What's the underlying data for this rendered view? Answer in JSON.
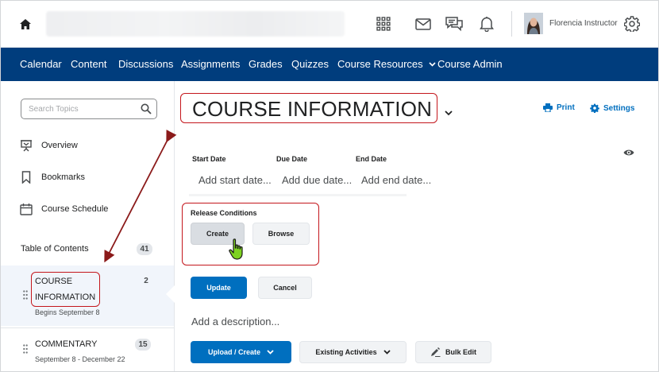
{
  "header": {
    "user_name": "Florencia Instructor",
    "icons": [
      "home-icon",
      "waffle-icon",
      "mail-icon",
      "chat-icon",
      "bell-icon",
      "gear-icon"
    ]
  },
  "nav": {
    "items": [
      {
        "label": "Calendar"
      },
      {
        "label": "Content"
      },
      {
        "label": "Discussions"
      },
      {
        "label": "Assignments"
      },
      {
        "label": "Grades"
      },
      {
        "label": "Quizzes"
      },
      {
        "label": "Course Resources",
        "has_menu": true
      },
      {
        "label": "Course Admin"
      }
    ]
  },
  "sidebar": {
    "search_placeholder": "Search Topics",
    "links": [
      {
        "label": "Overview",
        "icon": "presentation-icon"
      },
      {
        "label": "Bookmarks",
        "icon": "bookmark-icon"
      },
      {
        "label": "Course Schedule",
        "icon": "calendar-icon"
      }
    ],
    "toc_label": "Table of Contents",
    "toc_count": "41",
    "units": [
      {
        "title_line1": "COURSE",
        "title_line2": "INFORMATION",
        "subtitle": "Begins September 8",
        "count": "2",
        "selected": true
      },
      {
        "title_line1": "COMMENTARY",
        "subtitle": "September 8 - December 22",
        "count": "15",
        "selected": false
      }
    ]
  },
  "main": {
    "title": "COURSE INFORMATION",
    "print_label": "Print",
    "settings_label": "Settings",
    "dates": {
      "start_label": "Start Date",
      "due_label": "Due Date",
      "end_label": "End Date",
      "start_placeholder": "Add start date...",
      "due_placeholder": "Add due date...",
      "end_placeholder": "Add end date..."
    },
    "release_conditions": {
      "label": "Release Conditions",
      "create_label": "Create",
      "browse_label": "Browse"
    },
    "update_label": "Update",
    "cancel_label": "Cancel",
    "description_placeholder": "Add a description...",
    "toolbar": {
      "upload_label": "Upload / Create",
      "existing_label": "Existing Activities",
      "bulk_edit_label": "Bulk Edit"
    }
  },
  "colors": {
    "nav_background": "#003d7d",
    "primary": "#006fbf",
    "annotation": "#c4161c",
    "annotation_arrow": "#8b1a1a"
  }
}
